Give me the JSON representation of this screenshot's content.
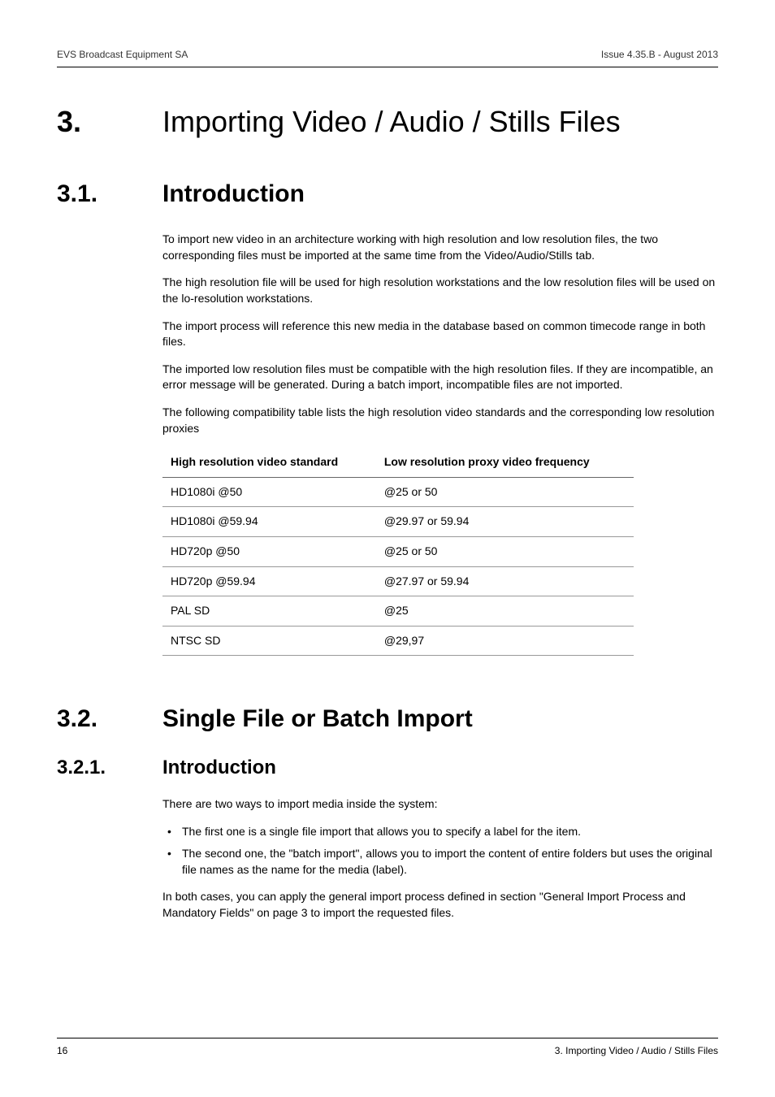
{
  "header": {
    "left": "EVS Broadcast Equipment SA",
    "right": "Issue 4.35.B - August 2013"
  },
  "chapter": {
    "number": "3.",
    "title": "Importing Video / Audio / Stills Files"
  },
  "sections": [
    {
      "number": "3.1.",
      "title": "Introduction",
      "paragraphs": [
        "To import new video in an architecture working with high resolution and low resolution files, the two corresponding files must be imported at the same time from the Video/Audio/Stills tab.",
        "The high resolution file will be used for high resolution workstations and the low resolution files will be used on the lo-resolution workstations.",
        "The import process will reference this new media in the database based on common timecode range in both files.",
        "The imported low resolution files must be compatible with the high resolution files. If they are incompatible, an error message will be generated. During a batch import, incompatible files are not imported.",
        "The following compatibility table lists the high resolution video standards and the corresponding low resolution proxies"
      ],
      "table": {
        "headers": [
          "High resolution video standard",
          "Low resolution proxy video frequency"
        ],
        "rows": [
          [
            "HD1080i @50",
            "@25 or 50"
          ],
          [
            "HD1080i @59.94",
            "@29.97 or 59.94"
          ],
          [
            "HD720p @50",
            "@25 or 50"
          ],
          [
            "HD720p @59.94",
            "@27.97 or 59.94"
          ],
          [
            "PAL SD",
            "@25"
          ],
          [
            "NTSC SD",
            "@29,97"
          ]
        ]
      }
    },
    {
      "number": "3.2.",
      "title": "Single File or Batch Import",
      "subsections": [
        {
          "number": "3.2.1.",
          "title": "Introduction",
          "intro": "There are two ways to import media inside the system:",
          "bullets": [
            "The first one is a single file import that allows you to specify a label for the item.",
            "The second one, the \"batch import\", allows you to import the content of entire folders but uses the original file names as the name for the media (label)."
          ],
          "after": "In both cases, you can apply the general import process defined in section \"General Import Process and Mandatory Fields\" on page 3 to import the requested files."
        }
      ]
    }
  ],
  "footer": {
    "left": "16",
    "right": "3. Importing Video / Audio / Stills Files"
  }
}
